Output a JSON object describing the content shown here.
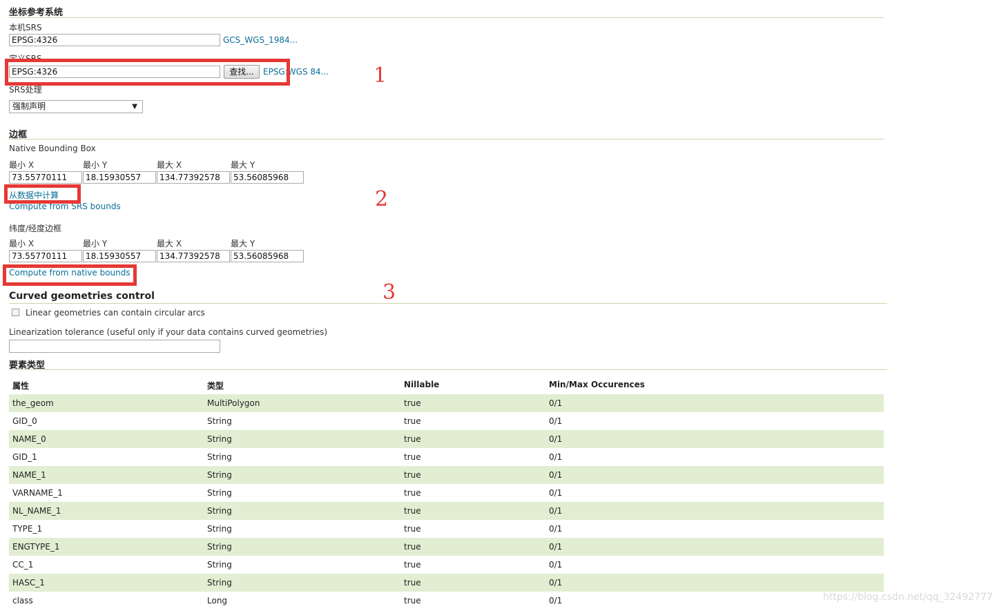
{
  "crs_section": {
    "title": "坐标参考系统",
    "native_srs_label": "本机SRS",
    "native_srs_value": "EPSG:4326",
    "native_srs_link": "GCS_WGS_1984...",
    "declared_srs_label": "定义SRS",
    "declared_srs_value": "EPSG:4326",
    "find_button": "查找...",
    "declared_srs_link": "EPSG:WGS 84...",
    "srs_handling_label": "SRS处理",
    "srs_handling_value": "强制声明"
  },
  "bbox_section": {
    "title": "边框",
    "native_label": "Native Bounding Box",
    "latlon_label": "纬度/经度边框",
    "col_labels": [
      "最小 X",
      "最小 Y",
      "最大 X",
      "最大 Y"
    ],
    "native_values": [
      "73.55770111",
      "18.15930557",
      "134.77392578",
      "53.56085968"
    ],
    "latlon_values": [
      "73.55770111",
      "18.15930557",
      "134.77392578",
      "53.56085968"
    ],
    "compute_from_data": "从数据中计算",
    "compute_from_srs": "Compute from SRS bounds",
    "compute_from_native": "Compute from native bounds"
  },
  "curved_section": {
    "title": "Curved geometries control",
    "checkbox_label": "Linear geometries can contain circular arcs",
    "tolerance_label": "Linearization tolerance (useful only if your data contains curved geometries)",
    "tolerance_value": ""
  },
  "feature_section": {
    "title": "要素类型",
    "headers": [
      "属性",
      "类型",
      "Nillable",
      "Min/Max Occurences"
    ],
    "rows": [
      [
        "the_geom",
        "MultiPolygon",
        "true",
        "0/1"
      ],
      [
        "GID_0",
        "String",
        "true",
        "0/1"
      ],
      [
        "NAME_0",
        "String",
        "true",
        "0/1"
      ],
      [
        "GID_1",
        "String",
        "true",
        "0/1"
      ],
      [
        "NAME_1",
        "String",
        "true",
        "0/1"
      ],
      [
        "VARNAME_1",
        "String",
        "true",
        "0/1"
      ],
      [
        "NL_NAME_1",
        "String",
        "true",
        "0/1"
      ],
      [
        "TYPE_1",
        "String",
        "true",
        "0/1"
      ],
      [
        "ENGTYPE_1",
        "String",
        "true",
        "0/1"
      ],
      [
        "CC_1",
        "String",
        "true",
        "0/1"
      ],
      [
        "HASC_1",
        "String",
        "true",
        "0/1"
      ],
      [
        "class",
        "Long",
        "true",
        "0/1"
      ]
    ]
  },
  "annotations": [
    "1",
    "2",
    "3"
  ],
  "watermark": "https://blog.csdn.net/qq_32492777",
  "colors": {
    "annotation_red": "#e53935",
    "row_highlight": "#e2eed2",
    "link": "#0b6e99"
  }
}
